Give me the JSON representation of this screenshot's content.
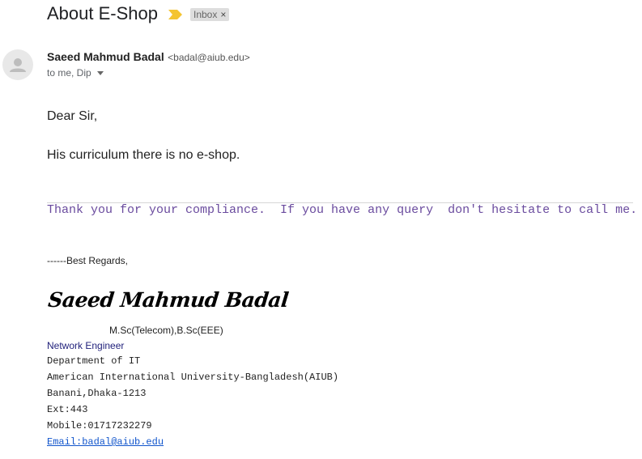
{
  "email": {
    "subject": "About E-Shop",
    "label": "Inbox",
    "label_close": "×",
    "sender_name": "Saeed Mahmud Badal",
    "sender_email": "<badal@aiub.edu>",
    "recipients": "to me, Dip"
  },
  "body": {
    "greeting": "Dear Sir,",
    "line1": "His curriculum there is no e-shop.",
    "thanks": "Thank you for your compliance.  If you have any query  don't hesitate to call me."
  },
  "signature": {
    "regards": "------Best Regards,",
    "name": "Saeed Mahmud Badal",
    "degrees": "M.Sc(Telecom),B.Sc(EEE)",
    "title": "Network Engineer",
    "department": "Department of IT",
    "university": "American International University-Bangladesh(AIUB)",
    "address": "Banani,Dhaka-1213",
    "ext": "Ext:443",
    "mobile": "Mobile:01717232279",
    "email_link": "Email:badal@aiub.edu"
  },
  "colors": {
    "important_marker": "#f4c430",
    "quote_text": "#6a4b9e",
    "link": "#1155cc",
    "title_text": "#1f1f7a"
  },
  "icons": {
    "important": "important-marker-icon",
    "avatar": "person-avatar-icon",
    "dropdown": "caret-down-icon"
  }
}
